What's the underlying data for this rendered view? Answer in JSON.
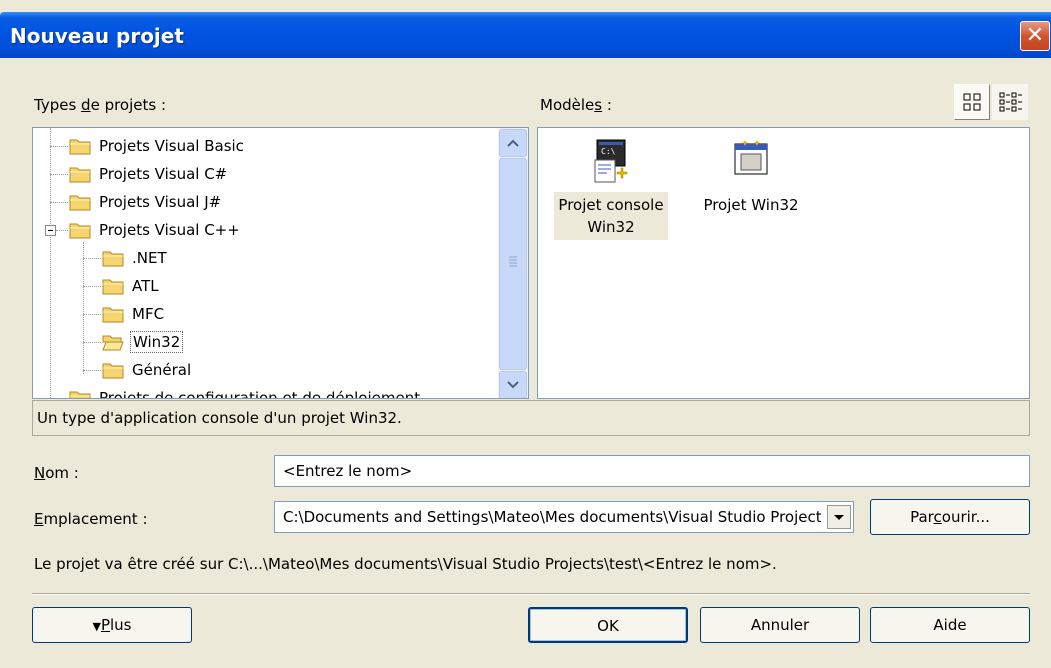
{
  "window": {
    "title": "Nouveau projet",
    "close": "✕"
  },
  "project_types": {
    "label_pre": "Types ",
    "label_key": "d",
    "label_post": "e projets :",
    "items": [
      {
        "label": "Projets Visual Basic"
      },
      {
        "label": "Projets Visual C#"
      },
      {
        "label": "Projets Visual J#"
      },
      {
        "label": "Projets Visual C++"
      },
      {
        "label": ".NET"
      },
      {
        "label": "ATL"
      },
      {
        "label": "MFC"
      },
      {
        "label": "Win32"
      },
      {
        "label": "Général"
      },
      {
        "label": "Projets de configuration et de déploiement"
      }
    ]
  },
  "templates": {
    "label_pre": "Modèle",
    "label_key": "s",
    "label_post": " :",
    "items": [
      {
        "line1": "Projet console",
        "line2": "Win32",
        "icon": "console-app-icon"
      },
      {
        "line1": "Projet Win32",
        "line2": "",
        "icon": "win32-app-icon"
      }
    ]
  },
  "description": "Un type d'application console d'un projet Win32.",
  "name": {
    "label_key": "N",
    "label_post": "om :",
    "value": "<Entrez le nom>"
  },
  "location": {
    "label_key": "E",
    "label_post": "mplacement :",
    "value": "C:\\Documents and Settings\\Mateo\\Mes documents\\Visual Studio Projects\\test"
  },
  "browse": {
    "pre": "Par",
    "key": "c",
    "post": "ourir..."
  },
  "info": "Le projet va être créé sur C:\\...\\Mateo\\Mes documents\\Visual Studio Projects\\test\\<Entrez le nom>.",
  "buttons": {
    "more_arrow": "▼",
    "more_key": "P",
    "more_post": "lus",
    "ok": "OK",
    "cancel": "Annuler",
    "help": "Aide"
  }
}
